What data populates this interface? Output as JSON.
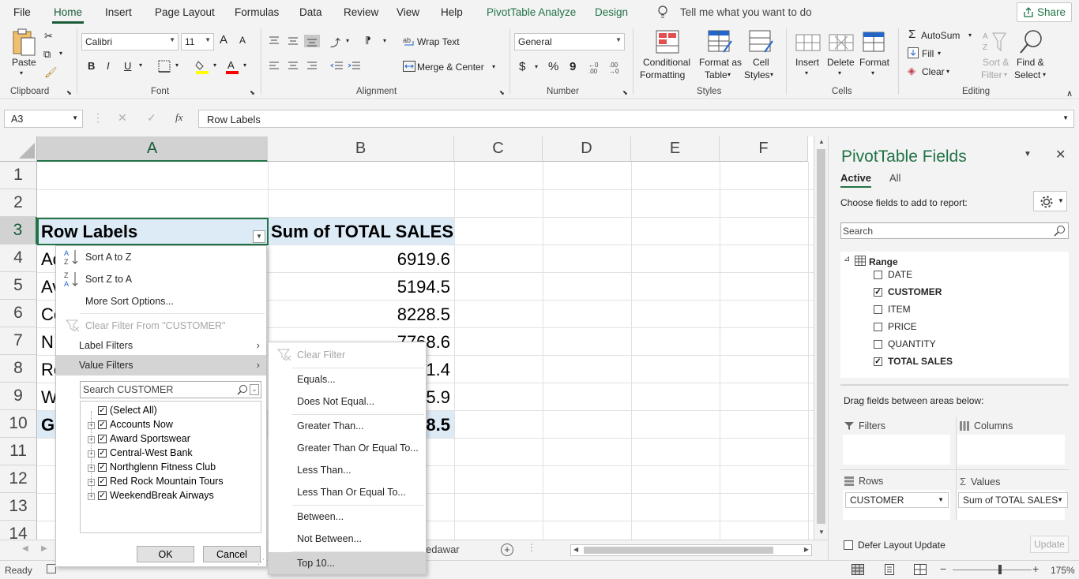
{
  "tabs": [
    "File",
    "Home",
    "Insert",
    "Page Layout",
    "Formulas",
    "Data",
    "Review",
    "View",
    "Help",
    "PivotTable Analyze",
    "Design"
  ],
  "tell_me": "Tell me what you want to do",
  "share": "Share",
  "ribbon": {
    "clipboard": {
      "label": "Clipboard",
      "paste": "Paste"
    },
    "font": {
      "label": "Font",
      "name": "Calibri",
      "size": "11",
      "bold": "B",
      "italic": "I",
      "underline": "U",
      "grow": "A",
      "shrink": "A"
    },
    "alignment": {
      "label": "Alignment",
      "wrap": "Wrap Text",
      "merge": "Merge & Center"
    },
    "number": {
      "label": "Number",
      "format": "General",
      "currency": "$",
      "percent": "%",
      "comma": "9"
    },
    "styles": {
      "label": "Styles",
      "cond1": "Conditional",
      "cond2": "Formatting",
      "fmt1": "Format as",
      "fmt2": "Table",
      "cell1": "Cell",
      "cell2": "Styles"
    },
    "cells": {
      "label": "Cells",
      "insert": "Insert",
      "delete": "Delete",
      "format": "Format"
    },
    "editing": {
      "label": "Editing",
      "autosum": "AutoSum",
      "fill": "Fill",
      "clear": "Clear",
      "sort1": "Sort &",
      "sort2": "Filter",
      "find1": "Find &",
      "find2": "Select"
    }
  },
  "formula_bar": {
    "name_box": "A3",
    "fx": "fx",
    "value": "Row Labels"
  },
  "grid": {
    "columns": [
      "A",
      "B",
      "C",
      "D",
      "E",
      "F"
    ],
    "rows": [
      "1",
      "2",
      "3",
      "4",
      "5",
      "6",
      "7",
      "8",
      "9",
      "10",
      "11",
      "12",
      "13",
      "14"
    ],
    "header_a": "Row Labels",
    "header_b": "Sum of TOTAL SALES",
    "a_fragments": [
      "Ac",
      "Av",
      "Ce",
      "N",
      "Re",
      "W",
      "G"
    ],
    "b_values": [
      "6919.6",
      "5194.5",
      "8228.5",
      "7768.6",
      "1.4",
      "5.9",
      "8.5"
    ]
  },
  "filter_menu": {
    "sort_az": "Sort A to Z",
    "sort_za": "Sort Z to A",
    "more_sort": "More Sort Options...",
    "clear_filter": "Clear Filter From \"CUSTOMER\"",
    "label_filters": "Label Filters",
    "value_filters": "Value Filters",
    "search_placeholder": "Search CUSTOMER",
    "items": [
      {
        "label": "(Select All)",
        "checked": true
      },
      {
        "label": "Accounts Now",
        "checked": true
      },
      {
        "label": "Award Sportswear",
        "checked": true
      },
      {
        "label": "Central-West Bank",
        "checked": true
      },
      {
        "label": "Northglenn Fitness Club",
        "checked": true
      },
      {
        "label": "Red Rock Mountain Tours",
        "checked": true
      },
      {
        "label": "WeekendBreak Airways",
        "checked": true
      }
    ],
    "ok": "OK",
    "cancel": "Cancel"
  },
  "value_submenu": {
    "clear": "Clear Filter",
    "items": [
      "Equals...",
      "Does Not Equal...",
      "Greater Than...",
      "Greater Than Or Equal To...",
      "Less Than...",
      "Less Than Or Equal To...",
      "Between...",
      "Not Between...",
      "Top 10..."
    ]
  },
  "sheet_tab_fragment": "edawar",
  "status": {
    "ready": "Ready",
    "zoom": "175%"
  },
  "pivot_pane": {
    "title": "PivotTable Fields",
    "tab_active": "Active",
    "tab_all": "All",
    "choose": "Choose fields to add to report:",
    "search_placeholder": "Search",
    "range": "Range",
    "fields": [
      {
        "label": "DATE",
        "checked": false
      },
      {
        "label": "CUSTOMER",
        "checked": true
      },
      {
        "label": "ITEM",
        "checked": false
      },
      {
        "label": "PRICE",
        "checked": false
      },
      {
        "label": "QUANTITY",
        "checked": false
      },
      {
        "label": "TOTAL SALES",
        "checked": true
      }
    ],
    "drag": "Drag fields between areas below:",
    "filters": "Filters",
    "columns": "Columns",
    "rows": "Rows",
    "values": "Values",
    "rows_field": "CUSTOMER",
    "values_field": "Sum of TOTAL SALES",
    "defer": "Defer Layout Update",
    "update": "Update"
  },
  "colors": {
    "accent": "#217346",
    "dark_green": "#185c37",
    "pivot_header": "#ddebf7",
    "highlight": "#d4d4d4"
  }
}
